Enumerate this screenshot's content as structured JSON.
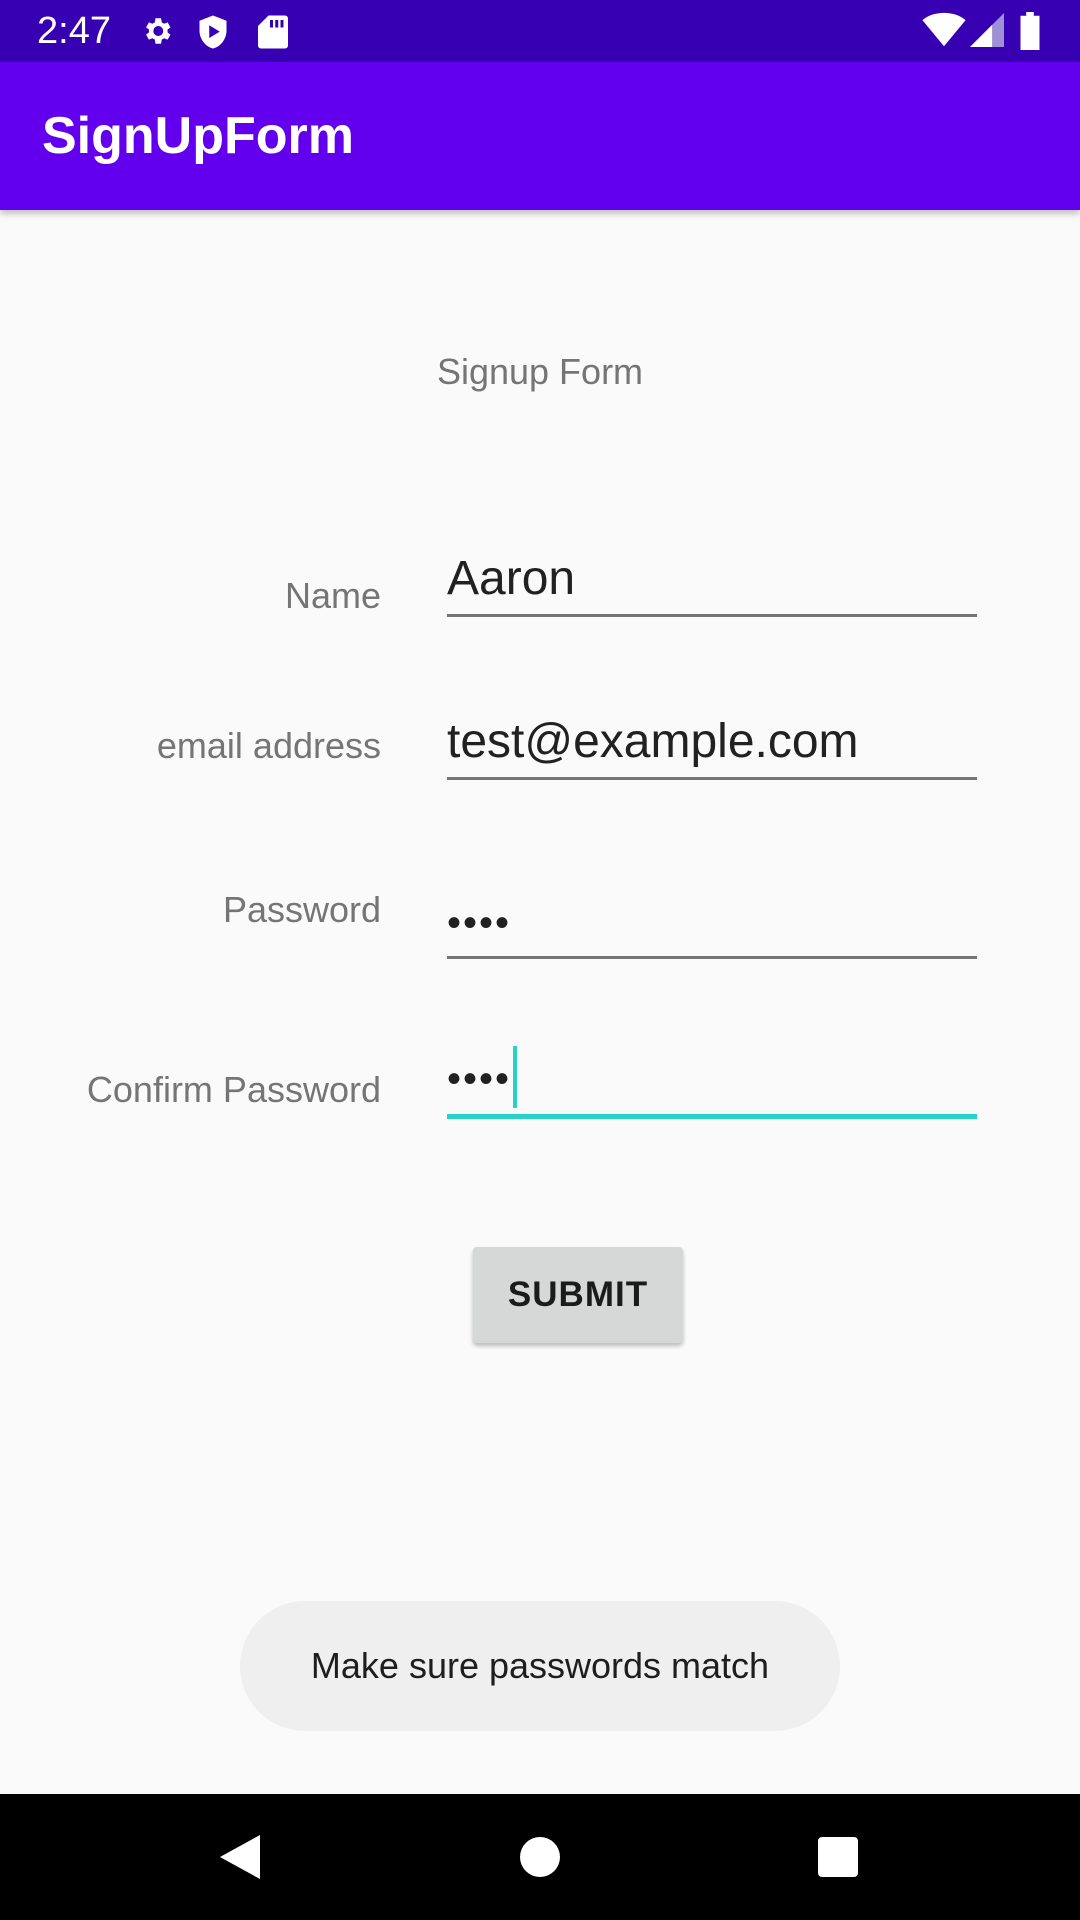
{
  "status_bar": {
    "time": "2:47",
    "icons_left": [
      "gear-icon",
      "shield-play-icon",
      "sd-card-icon"
    ],
    "icons_right": [
      "wifi-icon",
      "cell-signal-icon",
      "battery-icon"
    ]
  },
  "app_bar": {
    "title": "SignUpForm"
  },
  "form": {
    "heading": "Signup Form",
    "name_label": "Name",
    "name_value": "Aaron",
    "email_label": "email address",
    "email_value": "test@example.com",
    "password_label": "Password",
    "password_value": "••••",
    "confirm_label": "Confirm Password",
    "confirm_value": "••••",
    "submit_label": "SUBMIT"
  },
  "toast": {
    "message": "Make sure passwords match"
  },
  "nav_bar": {
    "buttons": [
      "back-icon",
      "home-icon",
      "recents-icon"
    ]
  },
  "colors": {
    "status_bar": "#3700b3",
    "app_bar": "#6200ee",
    "focus_accent": "#26d3c7",
    "background": "#fafafa"
  }
}
